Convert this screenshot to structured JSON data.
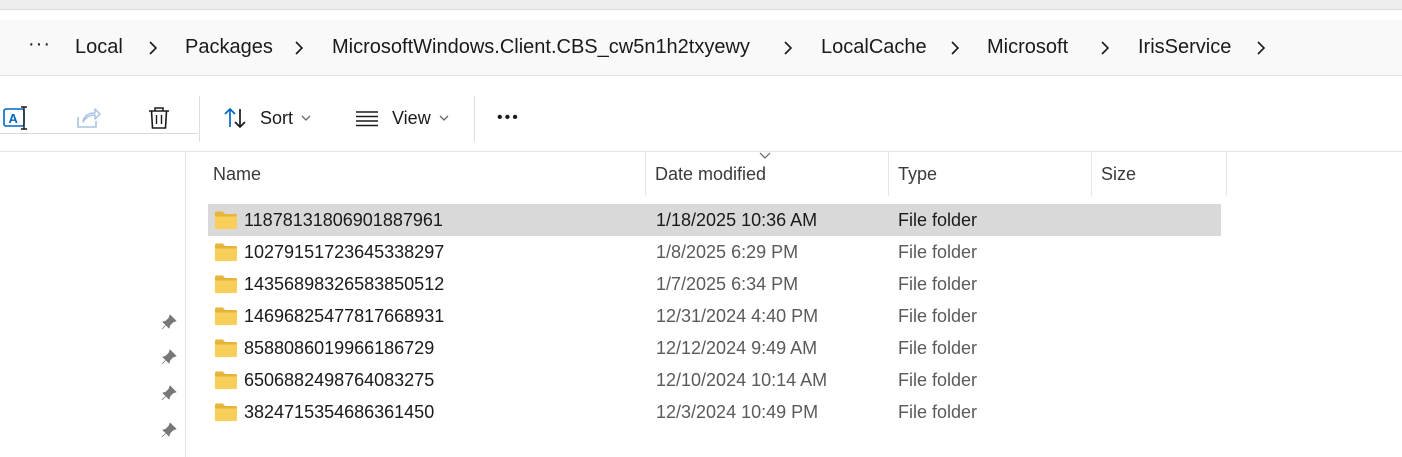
{
  "breadcrumb": {
    "overflow": "···",
    "items": [
      "Local",
      "Packages",
      "MicrosoftWindows.Client.CBS_cw5n1h2txyewy",
      "LocalCache",
      "Microsoft",
      "IrisService"
    ]
  },
  "toolbar": {
    "sort_label": "Sort",
    "view_label": "View",
    "more_label": "•••",
    "icons": [
      "rename-icon",
      "share-icon",
      "delete-icon",
      "sort-icon",
      "view-icon",
      "more-icon"
    ]
  },
  "columns": {
    "name": "Name",
    "date": "Date modified",
    "type": "Type",
    "size": "Size"
  },
  "files": [
    {
      "name": "11878131806901887961",
      "date": "1/18/2025 10:36 AM",
      "type": "File folder",
      "selected": true
    },
    {
      "name": "10279151723645338297",
      "date": "1/8/2025 6:29 PM",
      "type": "File folder",
      "selected": false
    },
    {
      "name": "14356898326583850512",
      "date": "1/7/2025 6:34 PM",
      "type": "File folder",
      "selected": false
    },
    {
      "name": "14696825477817668931",
      "date": "12/31/2024 4:40 PM",
      "type": "File folder",
      "selected": false
    },
    {
      "name": "8588086019966186729",
      "date": "12/12/2024 9:49 AM",
      "type": "File folder",
      "selected": false
    },
    {
      "name": "6506882498764083275",
      "date": "12/10/2024 10:14 AM",
      "type": "File folder",
      "selected": false
    },
    {
      "name": "3824715354686361450",
      "date": "12/3/2024 10:49 PM",
      "type": "File folder",
      "selected": false
    }
  ],
  "colors": {
    "selection": "#d9d9d9",
    "folder": "#f4c542",
    "accent": "#0067c0"
  }
}
